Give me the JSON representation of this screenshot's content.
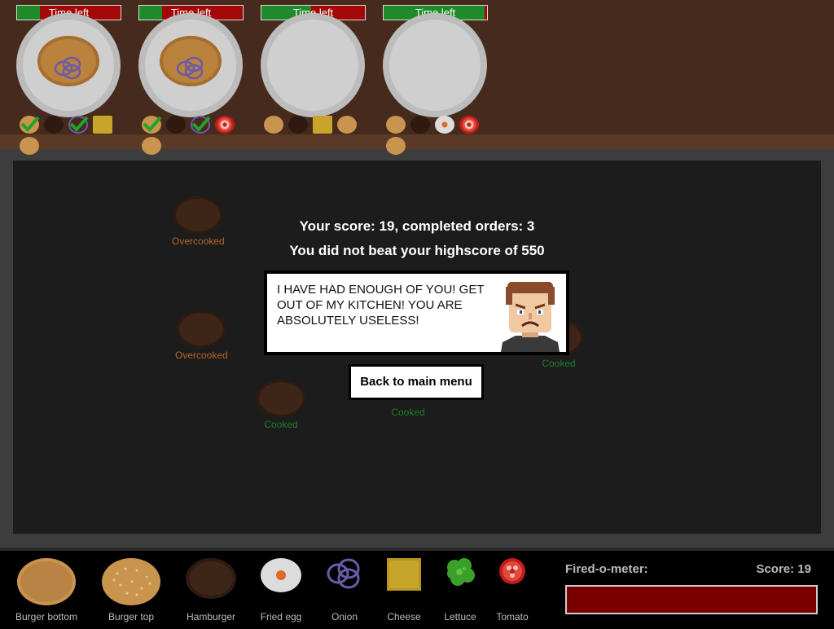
{
  "orders": [
    {
      "timer_label": "Time left",
      "time_left_fraction": 0.22,
      "plate": "onion-burger",
      "requirements": [
        "burger-bottom",
        "hamburger",
        "onion",
        "cheese",
        "burger-top"
      ],
      "checked": [
        0,
        2
      ]
    },
    {
      "timer_label": "Time left",
      "time_left_fraction": 0.22,
      "plate": "onion-burger",
      "requirements": [
        "burger-bottom",
        "hamburger",
        "onion",
        "tomato",
        "burger-top"
      ],
      "checked": [
        0,
        2
      ]
    },
    {
      "timer_label": "Time left",
      "time_left_fraction": 0.48,
      "plate": "empty",
      "requirements": [
        "burger-bottom",
        "hamburger",
        "cheese",
        "burger-top"
      ],
      "checked": []
    },
    {
      "timer_label": "Time left",
      "time_left_fraction": 0.98,
      "plate": "empty",
      "requirements": [
        "burger-bottom",
        "hamburger",
        "fried-egg",
        "tomato",
        "burger-top"
      ],
      "checked": []
    }
  ],
  "workspace_items": [
    {
      "status": "Overcooked",
      "kind": "hamburger"
    },
    {
      "status": "Overcooked",
      "kind": "hamburger"
    },
    {
      "status": "Cooked",
      "kind": "hamburger"
    },
    {
      "status": "Cooked",
      "kind": "hamburger"
    },
    {
      "status": "Cooked",
      "kind": "hamburger"
    }
  ],
  "game_over": {
    "score_text": "Your score: 19, completed orders: 3",
    "highscore_text": "You did not beat your highscore of 550",
    "chef_message": "I HAVE HAD ENOUGH OF YOU! GET OUT OF MY KITCHEN! YOU ARE ABSOLUTELY USELESS!",
    "back_button": "Back to main menu"
  },
  "ingredients": [
    {
      "label": "Burger bottom",
      "icon": "burger-bottom-icon"
    },
    {
      "label": "Burger top",
      "icon": "burger-top-icon"
    },
    {
      "label": "Hamburger",
      "icon": "hamburger-patty-icon"
    },
    {
      "label": "Fried egg",
      "icon": "fried-egg-icon"
    },
    {
      "label": "Onion",
      "icon": "onion-icon"
    },
    {
      "label": "Cheese",
      "icon": "cheese-icon"
    },
    {
      "label": "Lettuce",
      "icon": "lettuce-icon"
    },
    {
      "label": "Tomato",
      "icon": "tomato-icon"
    }
  ],
  "hud": {
    "fired_label": "Fired-o-meter:",
    "score_label": "Score: 19",
    "fired_level": 1.0
  },
  "colors": {
    "timer_green": "#1f8a2a",
    "timer_red": "#a30808",
    "overcooked": "#b5652a",
    "cooked": "#1f7d28",
    "fired_meter": "#7a0000"
  }
}
